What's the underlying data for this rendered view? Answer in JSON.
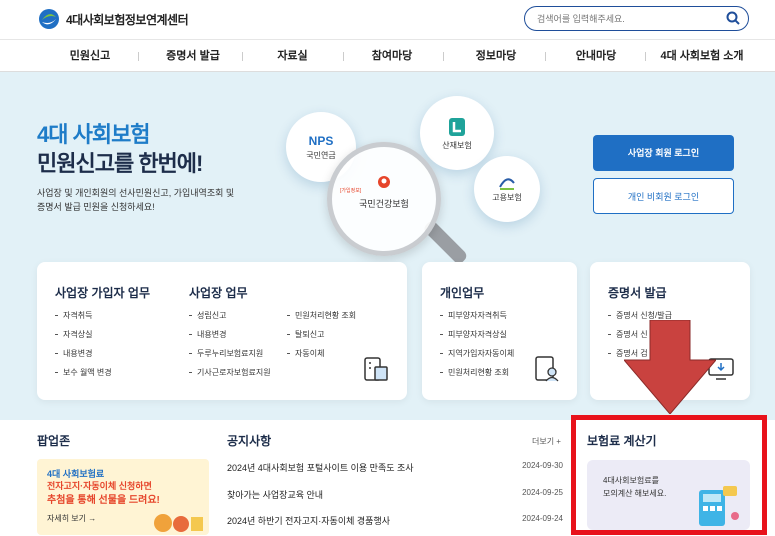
{
  "header": {
    "logo_text": "4대사회보험정보연계센터",
    "search_placeholder": "검색어를 입력해주세요."
  },
  "nav": {
    "items": [
      "민원신고",
      "증명서 발급",
      "자료실",
      "참여마당",
      "정보마당",
      "안내마당",
      "4대 사회보험 소개"
    ]
  },
  "hero": {
    "title_line1": "4대 사회보험",
    "title_line2": "민원신고를 한번에!",
    "desc_line1": "사업장 및 개인회원의 선사민원신고, 가입내역조회 및",
    "desc_line2": "증명서 발급 민원을 신청하세요!",
    "bubbles": {
      "nps_logo": "NPS",
      "nps_label": "국민연금",
      "nhis_small": "[가입정보]",
      "nhis_label": "국민건강보험",
      "comwel_label": "산재보험",
      "employ_label": "고용보험"
    },
    "login_business": "사업장 회원 로그인",
    "login_personal": "개인 비회원 로그인"
  },
  "cards": {
    "c1": {
      "title": "사업장 가입자 업무",
      "items": [
        "자격취득",
        "자격상실",
        "내용변경",
        "보수 월액 변경"
      ]
    },
    "c2": {
      "title": "사업장 업무",
      "items_left": [
        "성립신고",
        "내용변경",
        "두루누리보험료지원",
        "기사근로자보험료지원"
      ],
      "items_right": [
        "민원처리현황 조회",
        "탈퇴신고",
        "자동이체"
      ]
    },
    "c3": {
      "title": "개인업무",
      "items": [
        "피부양자자격취득",
        "피부양자자격상실",
        "지역가입자자동이체",
        "민원처리현황 조회"
      ]
    },
    "c4": {
      "title": "증명서 발급",
      "items": [
        "증명서 신청/발급",
        "증명서 신",
        "증명서 검"
      ]
    }
  },
  "popup_zone": {
    "title": "팝업존",
    "line1": "4대 사회보험료",
    "line2": "전자고지·자동이체 신청하면",
    "line3": "추첨을 통해 선물을 드려요!",
    "link": "자세히 보기  →"
  },
  "notices": {
    "title": "공지사항",
    "more": "더보기  +",
    "rows": [
      {
        "title": "2024년 4대사회보험 포털사이트 이용 만족도 조사",
        "date": "2024-09-30"
      },
      {
        "title": "찾아가는 사업장교육 안내",
        "date": "2024-09-25"
      },
      {
        "title": "2024년 하반기 전자고지·자동이체 경품행사",
        "date": "2024-09-24"
      }
    ]
  },
  "calculator": {
    "title": "보험료 계산기",
    "line1": "4대사회보험료를",
    "line2": "모의계산 해보세요."
  },
  "colors": {
    "primary": "#1f6fc4",
    "hero_bg": "#e2f1f7",
    "highlight_red": "#e8121b",
    "arrow_red": "#c9423f"
  }
}
